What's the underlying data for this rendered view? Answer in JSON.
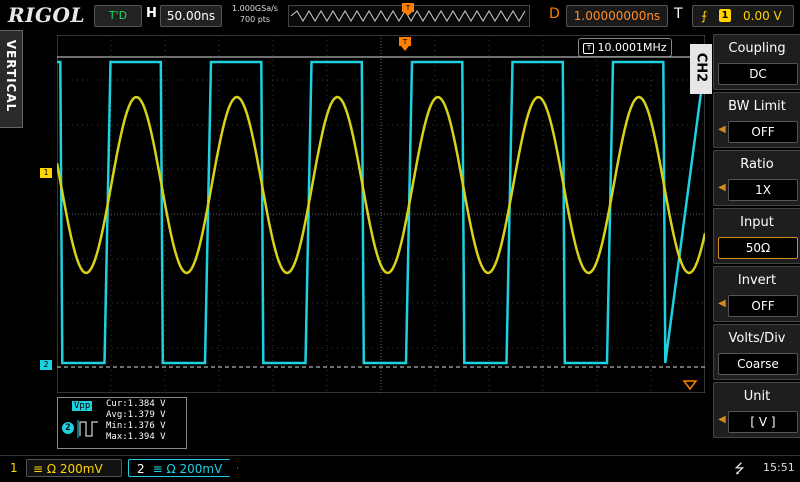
{
  "header": {
    "logo": "RIGOL",
    "run_status": "T'D",
    "timebase_label": "H",
    "timebase": "50.00ns",
    "sample_rate": "1.000GSa/s",
    "memory_depth": "700  pts",
    "delay_label": "D",
    "delay": "1.00000000ns",
    "trigger_label": "T",
    "trigger_source": "1",
    "trigger_level": "0.00 V"
  },
  "side_tab": {
    "label": "VERTICAL"
  },
  "channel_tag": "CH2",
  "frequency_counter": "10.0001MHz",
  "menu": [
    {
      "label": "Coupling",
      "value": "DC"
    },
    {
      "label": "BW Limit",
      "value": "OFF"
    },
    {
      "label": "Ratio",
      "value": "1X"
    },
    {
      "label": "Input",
      "value": "50Ω"
    },
    {
      "label": "Invert",
      "value": "OFF"
    },
    {
      "label": "Volts/Div",
      "value": "Coarse"
    },
    {
      "label": "Unit",
      "value": "[ V ]"
    }
  ],
  "markers": {
    "ch1": "1",
    "ch2": "2"
  },
  "measurement": {
    "type": "Vpp",
    "channel": "2",
    "cur": "Cur:1.384 V",
    "avg": "Avg:1.379 V",
    "min": "Min:1.376 V",
    "max": "Max:1.394 V"
  },
  "bottom": {
    "ch1_num": "1",
    "ch1_setting": "≡ Ω  200mV",
    "ch2_num": "2",
    "ch2_setting": "≡ Ω  200mV",
    "time": "15:51"
  },
  "colors": {
    "ch1": "#ffd400",
    "ch2": "#1ed1e0",
    "accent": "#ff7f00"
  }
}
